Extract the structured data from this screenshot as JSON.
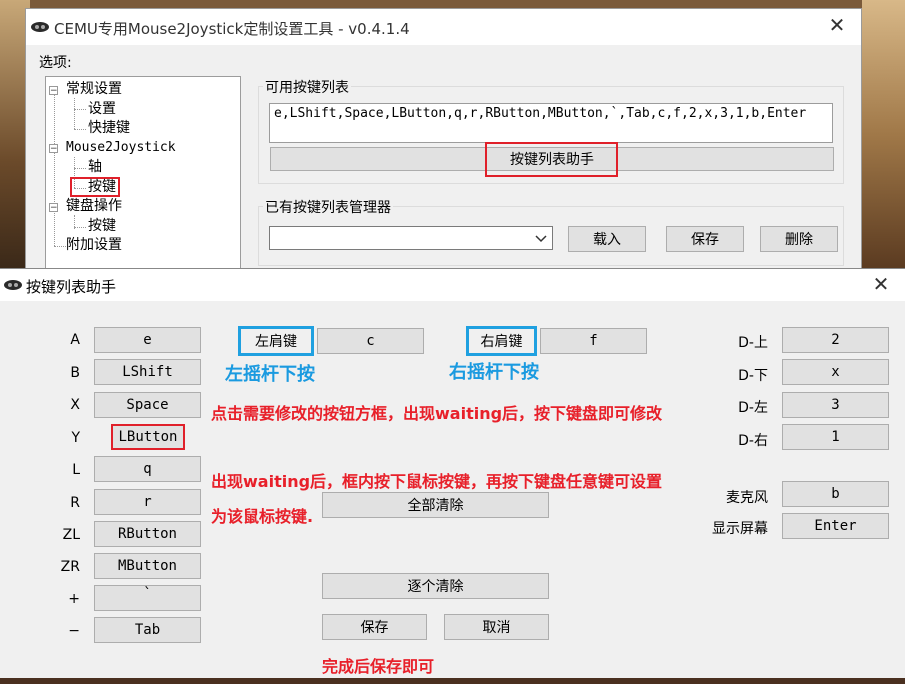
{
  "back_window": {
    "title": "CEMU专用Mouse2Joystick定制设置工具  -  v0.4.1.4",
    "close_glyph": "✕",
    "options_label": "选项:",
    "tree": [
      {
        "label": "常规设置",
        "box": "−"
      },
      {
        "label": "设置"
      },
      {
        "label": "快捷键"
      },
      {
        "label": "Mouse2Joystick",
        "box": "−"
      },
      {
        "label": "轴"
      },
      {
        "label": "按键"
      },
      {
        "label": "键盘操作",
        "box": "−"
      },
      {
        "label": "按键"
      },
      {
        "label": "附加设置"
      }
    ],
    "available_list": {
      "legend": "可用按键列表",
      "text": "e,LShift,Space,LButton,q,r,RButton,MButton,`,Tab,c,f,2,x,3,1,b,Enter",
      "helper_button": "按键列表助手"
    },
    "manager": {
      "legend": "已有按键列表管理器",
      "combo_value": "",
      "load_button": "载入",
      "save_button": "保存",
      "delete_button": "删除"
    }
  },
  "front_window": {
    "title": "按键列表助手",
    "close_glyph": "✕",
    "left_keys": [
      {
        "label": "A",
        "value": "e"
      },
      {
        "label": "B",
        "value": "LShift"
      },
      {
        "label": "X",
        "value": "Space"
      },
      {
        "label": "Y",
        "value": "LButton"
      },
      {
        "label": "L",
        "value": "q"
      },
      {
        "label": "R",
        "value": "r"
      },
      {
        "label": "ZL",
        "value": "RButton"
      },
      {
        "label": "ZR",
        "value": "MButton"
      },
      {
        "label": "+",
        "value": "`"
      },
      {
        "label": "−",
        "value": "Tab"
      }
    ],
    "left_stick": {
      "label": "左肩键",
      "value": "c"
    },
    "right_stick": {
      "label": "右肩键",
      "value": "f"
    },
    "dpad": [
      {
        "label": "D-上",
        "value": "2"
      },
      {
        "label": "D-下",
        "value": "x"
      },
      {
        "label": "D-左",
        "value": "3"
      },
      {
        "label": "D-右",
        "value": "1"
      }
    ],
    "mic": {
      "label": "麦克风",
      "value": "b"
    },
    "screen": {
      "label": "显示屏幕",
      "value": "Enter"
    },
    "clear_all_button": "全部清除",
    "clear_each_button": "逐个清除",
    "save_button": "保存",
    "cancel_button": "取消"
  },
  "annotations": {
    "left_stick_press": "左摇杆下按",
    "right_stick_press": "右摇杆下按",
    "tip_click": "点击需要修改的按钮方框，出现waiting后，按下键盘即可修改",
    "tip_mouse_1": "出现waiting后，框内按下鼠标按键，再按下键盘任意键可设置",
    "tip_mouse_2": "为该鼠标按键.",
    "tip_save": "完成后保存即可"
  },
  "colors": {
    "annotation_red": "#e8202a",
    "annotation_blue": "#1a9ae0"
  }
}
